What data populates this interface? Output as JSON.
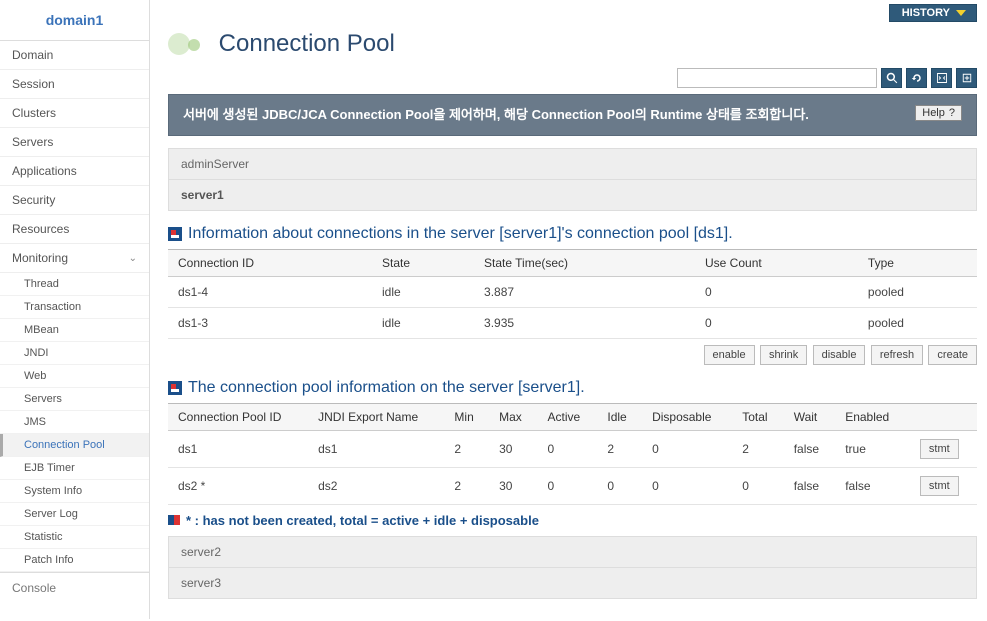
{
  "domain_title": "domain1",
  "history_label": "HISTORY",
  "page_title": "Connection Pool",
  "nav": {
    "items": [
      "Domain",
      "Session",
      "Clusters",
      "Servers",
      "Applications",
      "Security",
      "Resources"
    ],
    "monitoring_label": "Monitoring",
    "sub": [
      "Thread",
      "Transaction",
      "MBean",
      "JNDI",
      "Web",
      "Servers",
      "JMS",
      "Connection Pool",
      "EJB Timer",
      "System Info",
      "Server Log",
      "Statistic",
      "Patch Info"
    ],
    "active_sub": "Connection Pool",
    "console_label": "Console"
  },
  "search_placeholder": "",
  "banner_text": "서버에 생성된 JDBC/JCA Connection Pool을 제어하며, 해당 Connection Pool의 Runtime 상태를 조회합니다.",
  "help_label": "Help",
  "servers": {
    "admin": "adminServer",
    "s1": "server1",
    "s2": "server2",
    "s3": "server3"
  },
  "section1": {
    "title": "Information about connections in the server [server1]'s connection pool [ds1].",
    "headers": [
      "Connection ID",
      "State",
      "State Time(sec)",
      "Use Count",
      "Type"
    ],
    "rows": [
      {
        "c0": "ds1-4",
        "c1": "idle",
        "c2": "3.887",
        "c3": "0",
        "c4": "pooled"
      },
      {
        "c0": "ds1-3",
        "c1": "idle",
        "c2": "3.935",
        "c3": "0",
        "c4": "pooled"
      }
    ]
  },
  "pool_actions": [
    "enable",
    "shrink",
    "disable",
    "refresh",
    "create"
  ],
  "section2": {
    "title": "The connection pool information on the server [server1].",
    "headers": [
      "Connection Pool ID",
      "JNDI Export Name",
      "Min",
      "Max",
      "Active",
      "Idle",
      "Disposable",
      "Total",
      "Wait",
      "Enabled",
      ""
    ],
    "rows": [
      {
        "c0": "ds1",
        "c1": "ds1",
        "c2": "2",
        "c3": "30",
        "c4": "0",
        "c5": "2",
        "c6": "0",
        "c7": "2",
        "c8": "false",
        "c9": "true"
      },
      {
        "c0": "ds2 *",
        "c1": "ds2",
        "c2": "2",
        "c3": "30",
        "c4": "0",
        "c5": "0",
        "c6": "0",
        "c7": "0",
        "c8": "false",
        "c9": "false"
      }
    ],
    "row_btn": "stmt"
  },
  "footnote": "* : has not been created, total = active + idle + disposable"
}
